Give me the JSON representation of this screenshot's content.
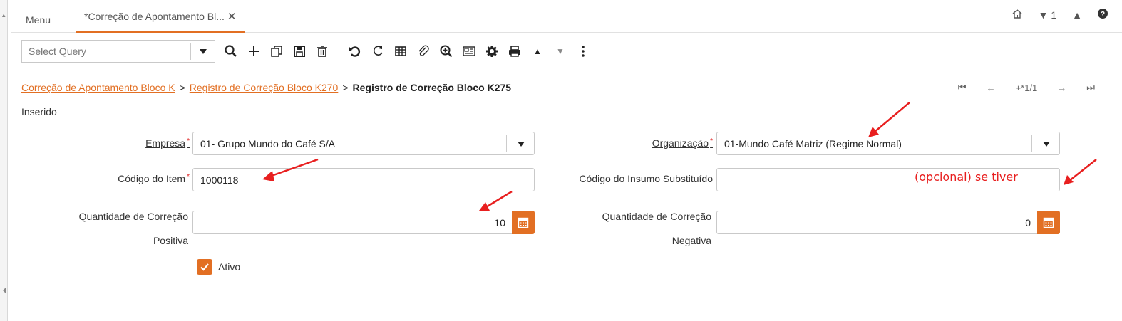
{
  "tabs": {
    "menu_label": "Menu",
    "active_label": "*Correção de Apontamento Bl...",
    "close_glyph": "✕",
    "right": {
      "home_icon": "home-icon",
      "window_count": "1",
      "help_icon": "help-icon"
    }
  },
  "toolbar": {
    "select_query_placeholder": "Select Query",
    "icons": [
      "search-icon",
      "new-record-icon",
      "copy-icon",
      "save-icon",
      "delete-icon",
      "undo-icon",
      "refresh-icon",
      "grid-toggle-icon",
      "attachment-icon",
      "zoom-icon",
      "report-icon",
      "settings-icon",
      "print-icon",
      "up-icon",
      "down-icon",
      "more-icon"
    ]
  },
  "breadcrumb": {
    "item1": "Correção de Apontamento Bloco K",
    "item2": "Registro de Correção Bloco K270",
    "current": "Registro de Correção Bloco K275",
    "separator": ">"
  },
  "record_nav": {
    "position": "+*1/1"
  },
  "status": "Inserido",
  "form": {
    "empresa_label": "Empresa",
    "empresa_value": "01- Grupo Mundo do Café S/A",
    "organizacao_label": "Organização",
    "organizacao_value": "01-Mundo Café Matriz (Regime Normal)",
    "codigo_item_label": "Código do Item",
    "codigo_item_value": "1000118",
    "codigo_insumo_label": "Código do Insumo Substituído",
    "codigo_insumo_value": "",
    "qtd_positiva_label_1": "Quantidade de Correção",
    "qtd_positiva_label_2": "Positiva",
    "qtd_positiva_value": "10",
    "qtd_negativa_label_1": "Quantidade de Correção",
    "qtd_negativa_label_2": "Negativa",
    "qtd_negativa_value": "0",
    "ativo_label": "Ativo",
    "ativo_checked": true,
    "required_mark": "*"
  },
  "annotation": {
    "note": "(opcional) se tiver"
  },
  "colors": {
    "accent": "#e26f23",
    "annotation": "#e81f1f"
  }
}
